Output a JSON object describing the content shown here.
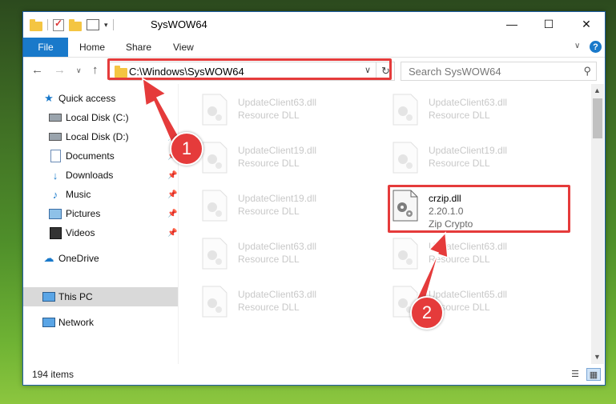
{
  "window": {
    "title": "SysWOW64"
  },
  "ribbon": {
    "tabs": [
      "File",
      "Home",
      "Share",
      "View"
    ]
  },
  "address": {
    "path": "C:\\Windows\\SysWOW64"
  },
  "search": {
    "placeholder": "Search SysWOW64"
  },
  "sidebar": {
    "items": [
      {
        "label": "Quick access",
        "icon": "star-icon"
      },
      {
        "label": "Local Disk (C:)",
        "icon": "drive-icon"
      },
      {
        "label": "Local Disk (D:)",
        "icon": "drive-icon"
      },
      {
        "label": "Documents",
        "icon": "documents-icon"
      },
      {
        "label": "Downloads",
        "icon": "download-icon"
      },
      {
        "label": "Music",
        "icon": "music-icon"
      },
      {
        "label": "Pictures",
        "icon": "pictures-icon"
      },
      {
        "label": "Videos",
        "icon": "videos-icon"
      },
      {
        "label": "OneDrive",
        "icon": "cloud-icon"
      },
      {
        "label": "This PC",
        "icon": "computer-icon"
      },
      {
        "label": "Network",
        "icon": "network-icon"
      }
    ]
  },
  "files": [
    {
      "name": "UpdateClient63.dll",
      "desc": "Resource DLL"
    },
    {
      "name": "UpdateClient63.dll",
      "desc": "Resource DLL"
    },
    {
      "name": "UpdateClient19.dll",
      "desc": "Resource DLL"
    },
    {
      "name": "UpdateClient19.dll",
      "desc": "Resource DLL"
    },
    {
      "name": "UpdateClient19.dll",
      "desc": "Resource DLL"
    },
    {
      "name": "crzip.dll",
      "version": "2.20.1.0",
      "desc": "Zip Crypto"
    },
    {
      "name": "UpdateClient63.dll",
      "desc": "Resource DLL"
    },
    {
      "name": "UpdateClient63.dll",
      "desc": "Resource DLL"
    },
    {
      "name": "UpdateClient63.dll",
      "desc": "Resource DLL"
    },
    {
      "name": "UpdateClient65.dll",
      "desc": "Resource DLL"
    }
  ],
  "status": {
    "item_count": "194 items"
  },
  "annotations": {
    "step1": "1",
    "step2": "2",
    "color": "#e53b3b"
  }
}
